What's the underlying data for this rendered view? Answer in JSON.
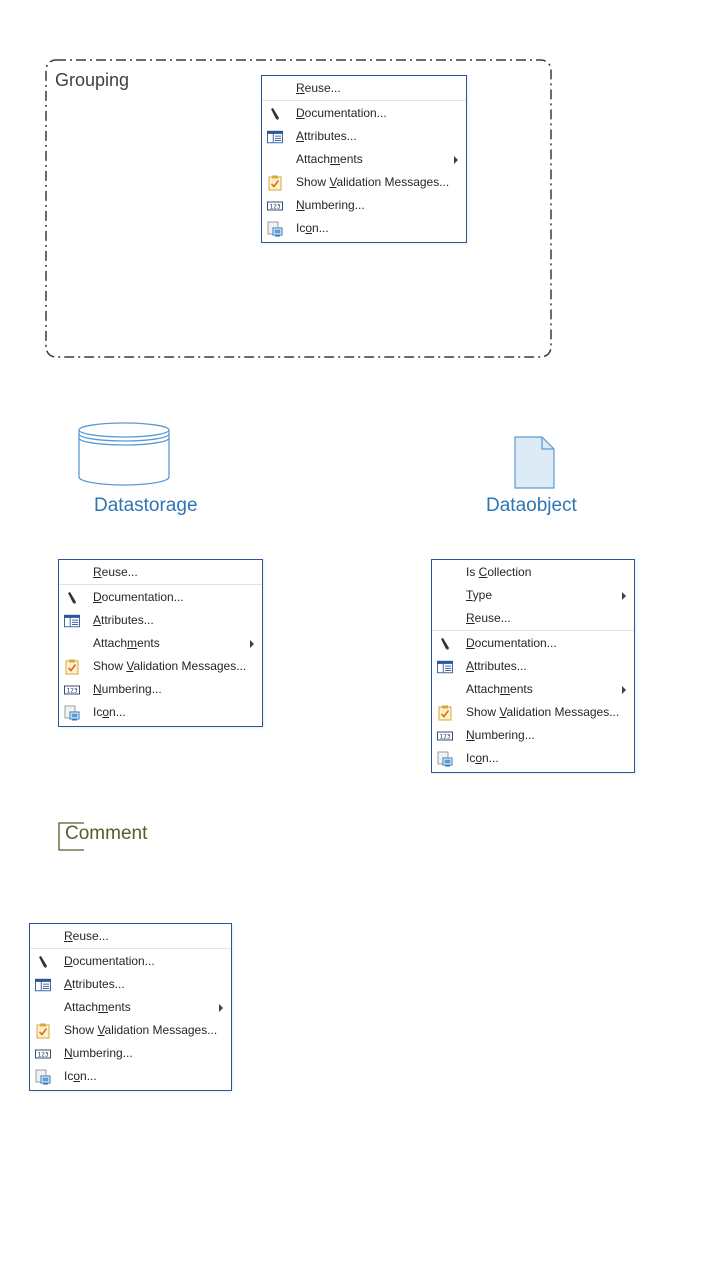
{
  "grouping": {
    "label": "Grouping"
  },
  "datastorage": {
    "label": "Datastorage"
  },
  "dataobject": {
    "label": "Dataobject"
  },
  "comment": {
    "label": "Comment"
  },
  "colors": {
    "menu_border": "#2b579a",
    "shape_stroke": "#5b9bd5",
    "shape_fill": "#ddebf7",
    "shape_label": "#2e75b6",
    "comment": "#4f6228"
  },
  "menu_grouping": {
    "items": [
      {
        "pre": "",
        "u": "R",
        "post": "euse...",
        "icon": null
      },
      {
        "pre": "",
        "u": "D",
        "post": "ocumentation...",
        "icon": "pencil-icon"
      },
      {
        "pre": "",
        "u": "A",
        "post": "ttributes...",
        "icon": "attributes-table-icon"
      },
      {
        "pre": "Attach",
        "u": "m",
        "post": "ents",
        "icon": null,
        "submenu": true
      },
      {
        "pre": "Show ",
        "u": "V",
        "post": "alidation Messages...",
        "icon": "validation-clipboard-icon"
      },
      {
        "pre": "",
        "u": "N",
        "post": "umbering...",
        "icon": "numbering-123-icon"
      },
      {
        "pre": "Ic",
        "u": "o",
        "post": "n...",
        "icon": "icon-image-icon"
      }
    ]
  },
  "menu_datastorage": {
    "items": [
      {
        "pre": "",
        "u": "R",
        "post": "euse...",
        "icon": null
      },
      {
        "pre": "",
        "u": "D",
        "post": "ocumentation...",
        "icon": "pencil-icon"
      },
      {
        "pre": "",
        "u": "A",
        "post": "ttributes...",
        "icon": "attributes-table-icon"
      },
      {
        "pre": "Attach",
        "u": "m",
        "post": "ents",
        "icon": null,
        "submenu": true
      },
      {
        "pre": "Show ",
        "u": "V",
        "post": "alidation Messages...",
        "icon": "validation-clipboard-icon"
      },
      {
        "pre": "",
        "u": "N",
        "post": "umbering...",
        "icon": "numbering-123-icon"
      },
      {
        "pre": "Ic",
        "u": "o",
        "post": "n...",
        "icon": "icon-image-icon"
      }
    ]
  },
  "menu_dataobject": {
    "items": [
      {
        "pre": "Is ",
        "u": "C",
        "post": "ollection",
        "icon": null
      },
      {
        "pre": "",
        "u": "T",
        "post": "ype",
        "icon": null,
        "submenu": true
      },
      {
        "pre": "",
        "u": "R",
        "post": "euse...",
        "icon": null
      },
      {
        "pre": "",
        "u": "D",
        "post": "ocumentation...",
        "icon": "pencil-icon"
      },
      {
        "pre": "",
        "u": "A",
        "post": "ttributes...",
        "icon": "attributes-table-icon"
      },
      {
        "pre": "Attach",
        "u": "m",
        "post": "ents",
        "icon": null,
        "submenu": true
      },
      {
        "pre": "Show ",
        "u": "V",
        "post": "alidation Messages...",
        "icon": "validation-clipboard-icon"
      },
      {
        "pre": "",
        "u": "N",
        "post": "umbering...",
        "icon": "numbering-123-icon"
      },
      {
        "pre": "Ic",
        "u": "o",
        "post": "n...",
        "icon": "icon-image-icon"
      }
    ]
  },
  "menu_comment": {
    "items": [
      {
        "pre": "",
        "u": "R",
        "post": "euse...",
        "icon": null
      },
      {
        "pre": "",
        "u": "D",
        "post": "ocumentation...",
        "icon": "pencil-icon"
      },
      {
        "pre": "",
        "u": "A",
        "post": "ttributes...",
        "icon": "attributes-table-icon"
      },
      {
        "pre": "Attach",
        "u": "m",
        "post": "ents",
        "icon": null,
        "submenu": true
      },
      {
        "pre": "Show ",
        "u": "V",
        "post": "alidation Messages...",
        "icon": "validation-clipboard-icon"
      },
      {
        "pre": "",
        "u": "N",
        "post": "umbering...",
        "icon": "numbering-123-icon"
      },
      {
        "pre": "Ic",
        "u": "o",
        "post": "n...",
        "icon": "icon-image-icon"
      }
    ]
  }
}
